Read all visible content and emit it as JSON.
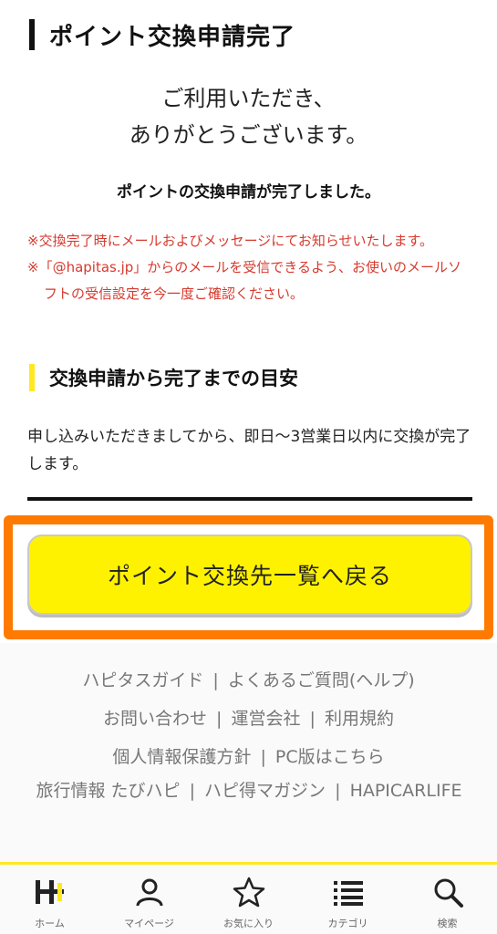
{
  "header": {
    "title": "ポイント交換申請完了"
  },
  "thanks": {
    "line1": "ご利用いただき、",
    "line2": "ありがとうございます。"
  },
  "done_message": "ポイントの交換申請が完了しました。",
  "notes": [
    "※交換完了時にメールおよびメッセージにてお知らせいたします。",
    "※「@hapitas.jp」からのメールを受信できるよう、お使いのメールソフトの受信設定を今一度ご確認ください。"
  ],
  "section": {
    "title": "交換申請から完了までの目安",
    "description": "申し込みいただきましてから、即日〜3営業日以内に交換が完了します。"
  },
  "back_button": {
    "label": "ポイント交換先一覧へ戻る"
  },
  "footer": {
    "links": [
      "ハピタスガイド",
      "よくあるご質問(ヘルプ)",
      "お問い合わせ",
      "運営会社",
      "利用規約",
      "個人情報保護方針",
      "PC版はこちら",
      "旅行情報 たびハピ",
      "ハピ得マガジン",
      "HAPICARLIFE"
    ],
    "separator": "|"
  },
  "tabbar": {
    "items": [
      {
        "label": "ホーム",
        "icon": "home-logo-icon"
      },
      {
        "label": "マイページ",
        "icon": "person-icon"
      },
      {
        "label": "お気に入り",
        "icon": "star-icon"
      },
      {
        "label": "カテゴリ",
        "icon": "list-icon"
      },
      {
        "label": "検索",
        "icon": "search-icon"
      }
    ]
  },
  "colors": {
    "accent_yellow": "#fff200",
    "highlight_orange": "#ff7a00",
    "note_red": "#d73a2e"
  }
}
